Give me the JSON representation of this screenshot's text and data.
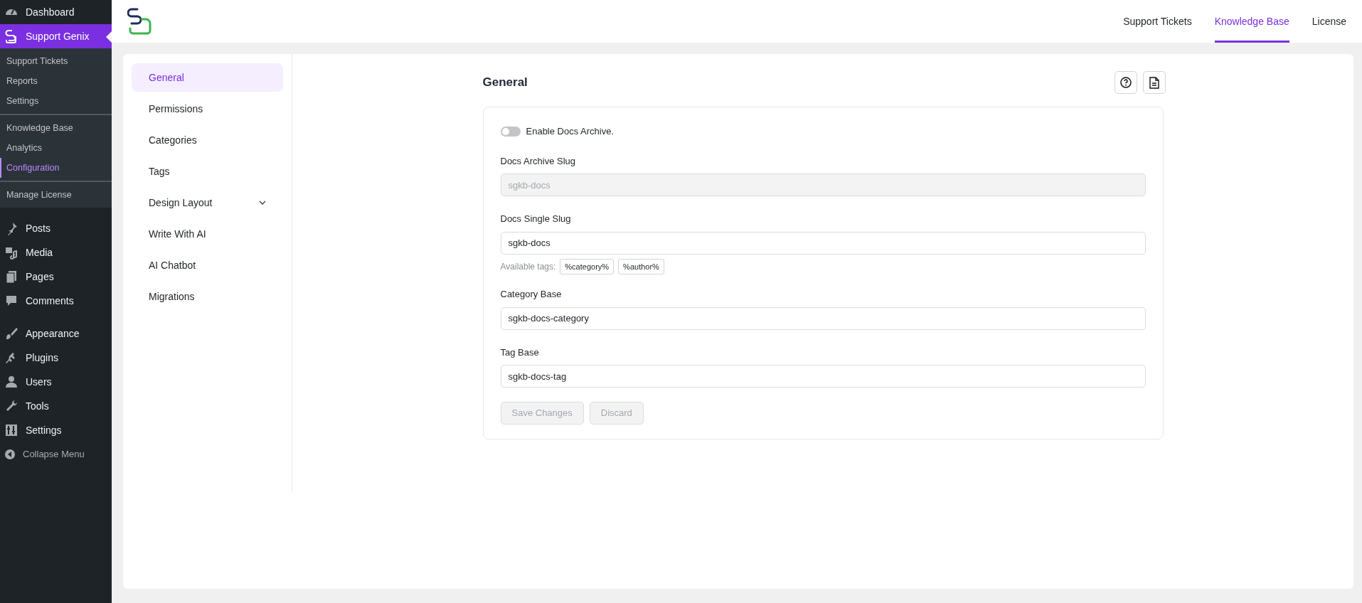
{
  "admin_menu": {
    "groups": [
      [
        {
          "label": "Dashboard",
          "selected": false
        },
        {
          "label": "Support Genix",
          "selected": true,
          "submenu": [
            [
              {
                "label": "Support Tickets",
                "selected": false
              },
              {
                "label": "Reports",
                "selected": false
              },
              {
                "label": "Settings",
                "selected": false
              }
            ],
            [
              {
                "label": "Knowledge Base",
                "selected": false
              },
              {
                "label": "Analytics",
                "selected": false
              },
              {
                "label": "Configuration",
                "selected": true
              }
            ],
            [
              {
                "label": "Manage License",
                "selected": false
              }
            ]
          ]
        }
      ],
      [
        {
          "label": "Posts",
          "selected": false
        },
        {
          "label": "Media",
          "selected": false
        },
        {
          "label": "Pages",
          "selected": false
        },
        {
          "label": "Comments",
          "selected": false
        }
      ],
      [
        {
          "label": "Appearance",
          "selected": false
        },
        {
          "label": "Plugins",
          "selected": false
        },
        {
          "label": "Users",
          "selected": false
        },
        {
          "label": "Tools",
          "selected": false
        },
        {
          "label": "Settings",
          "selected": false
        }
      ]
    ],
    "collapse": "Collapse Menu"
  },
  "header_tabs": [
    {
      "label": "Support Tickets",
      "selected": false
    },
    {
      "label": "Knowledge Base",
      "selected": true
    },
    {
      "label": "License",
      "selected": false
    }
  ],
  "settings_nav": [
    {
      "label": "General",
      "selected": true,
      "kind": "link"
    },
    {
      "label": "Permissions",
      "selected": false,
      "kind": "link"
    },
    {
      "label": "Categories",
      "selected": false,
      "kind": "link"
    },
    {
      "label": "Tags",
      "selected": false,
      "kind": "link"
    },
    {
      "label": "Design Layout",
      "selected": false,
      "kind": "dropdown"
    },
    {
      "label": "Write With AI",
      "selected": false,
      "kind": "link"
    },
    {
      "label": "AI Chatbot",
      "selected": false,
      "kind": "link"
    },
    {
      "label": "Migrations",
      "selected": false,
      "kind": "link"
    }
  ],
  "form": {
    "title": "General",
    "toggle": {
      "label": "Enable Docs Archive.",
      "on": false
    },
    "fields": [
      {
        "label": "Docs Archive Slug",
        "value": "sgkb-docs",
        "disabled": true
      },
      {
        "label": "Docs Single Slug",
        "value": "sgkb-docs",
        "disabled": false,
        "tags_label": "Available tags:",
        "tags": [
          "%category%",
          "%author%"
        ]
      },
      {
        "label": "Category Base",
        "value": "sgkb-docs-category",
        "disabled": false
      },
      {
        "label": "Tag Base",
        "value": "sgkb-docs-tag",
        "disabled": false
      }
    ],
    "buttons": [
      {
        "label": "Save Changes",
        "disabled": true
      },
      {
        "label": "Discard",
        "disabled": true
      }
    ]
  }
}
